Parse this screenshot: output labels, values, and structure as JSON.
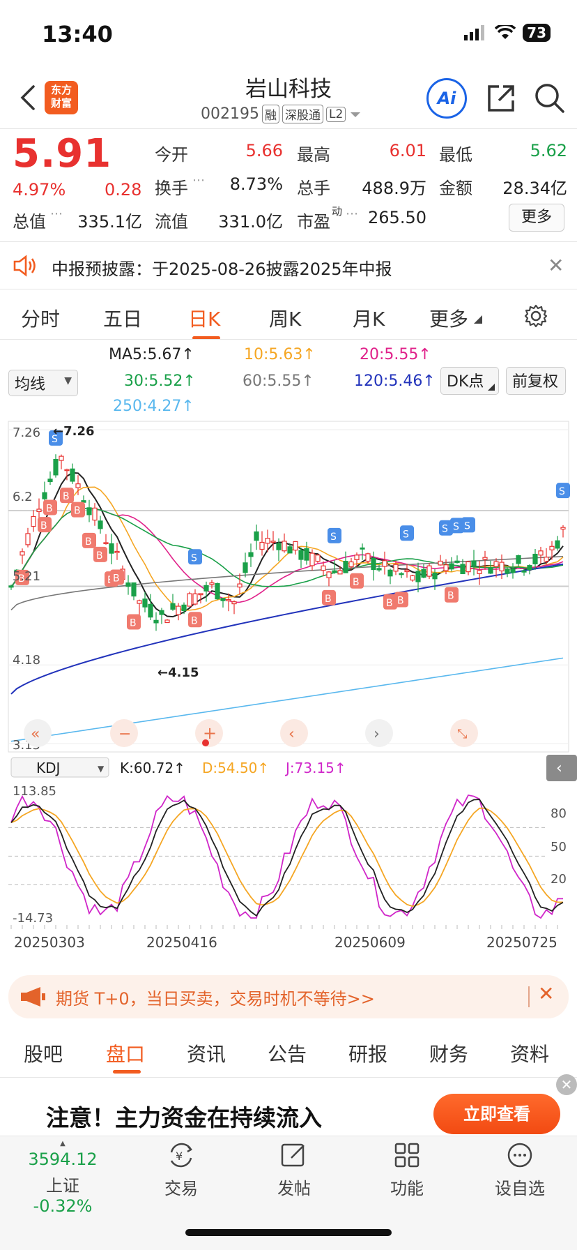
{
  "status_bar": {
    "time": "13:40",
    "battery": "73"
  },
  "header": {
    "logo_line1": "东方",
    "logo_line2": "财富",
    "name": "岩山科技",
    "code": "002195",
    "tags": [
      "融",
      "深股通",
      "L2"
    ],
    "ai_label": "Ai"
  },
  "quote": {
    "price": "5.91",
    "change_pct": "4.97%",
    "change": "0.28",
    "rows": [
      [
        {
          "label": "今开",
          "value": "5.66",
          "color": "red"
        },
        {
          "label": "最高",
          "value": "6.01",
          "color": "red"
        },
        {
          "label": "最低",
          "value": "5.62",
          "color": "green"
        }
      ],
      [
        {
          "label": "换手",
          "value": "8.73%"
        },
        {
          "label": "总手",
          "value": "488.9万"
        },
        {
          "label": "金额",
          "value": "28.34亿"
        }
      ]
    ],
    "total_mv_label": "总值",
    "total_mv": "335.1亿",
    "float_mv_label": "流值",
    "float_mv": "331.0亿",
    "pe_label": "市盈",
    "pe_sup": "动",
    "pe": "265.50",
    "more": "更多"
  },
  "notice": {
    "text": "中报预披露：于2025-08-26披露2025年中报"
  },
  "period_tabs": [
    "分时",
    "五日",
    "日K",
    "周K",
    "月K",
    "更多"
  ],
  "ma_legend": {
    "select": "均线",
    "ma5": "MA5:5.67",
    "ma10": "10:5.63",
    "ma20": "20:5.55",
    "ma30": "30:5.52",
    "ma60": "60:5.55",
    "ma120": "120:5.46",
    "ma250": "250:4.27",
    "dk": "DK点",
    "fq": "前复权",
    "colors": {
      "ma5": "#222222",
      "ma10": "#f5a623",
      "ma20": "#e0218a",
      "ma30": "#1aa049",
      "ma60": "#777777",
      "ma120": "#2233bb",
      "ma250": "#5ab8ee"
    }
  },
  "chart_data": {
    "type": "candlestick",
    "y_ticks": [
      "7.26",
      "6.2",
      "5.21",
      "4.18",
      "3.15"
    ],
    "high_label": "7.26",
    "low_label": "4.15",
    "ylim": [
      3.15,
      7.26
    ],
    "x_labels": [
      "20250303",
      "20250416",
      "20250609",
      "20250725"
    ],
    "kdj": {
      "select": "KDJ",
      "k": "K:60.72",
      "d": "D:54.50",
      "j": "J:73.15",
      "y_max_label": "113.85",
      "y_min_label": "-14.73",
      "levels": [
        "80",
        "50",
        "20"
      ]
    },
    "signals_b": 16,
    "signals_s": 7
  },
  "banner": {
    "text": "期货 T+0，当日买卖，交易时机不等待>>"
  },
  "bottom_tabs": [
    "股吧",
    "盘口",
    "资讯",
    "公告",
    "研报",
    "财务",
    "资料"
  ],
  "ad": {
    "text": "注意！主力资金在持续流入",
    "button": "立即查看"
  },
  "nav": {
    "index_value": "3594.12",
    "index_name": "上证",
    "index_change": "-0.32%",
    "items": [
      "交易",
      "发帖",
      "功能",
      "设自选"
    ]
  }
}
